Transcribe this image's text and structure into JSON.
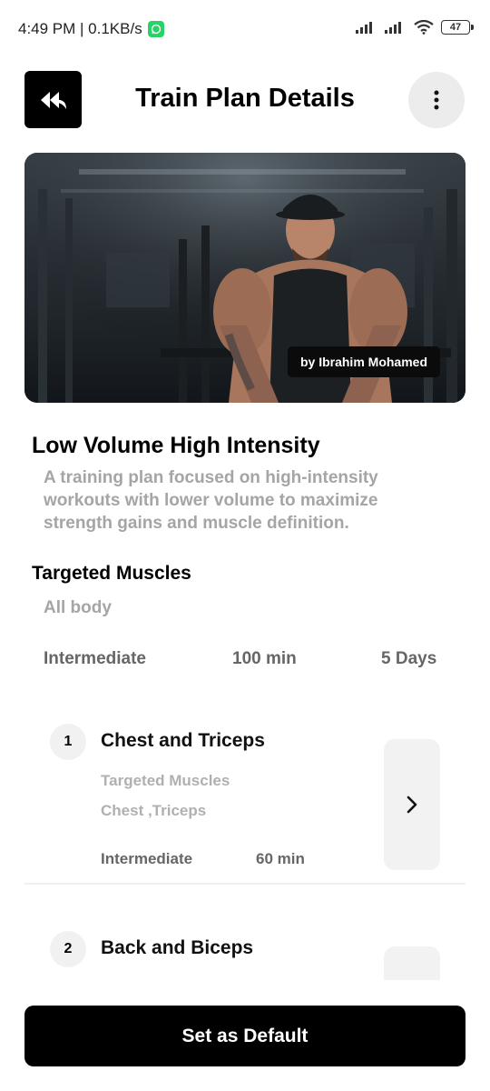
{
  "status_bar": {
    "time_speed": "4:49 PM | 0.1KB/s",
    "battery": "47"
  },
  "header": {
    "title": "Train Plan Details",
    "back_icon": "double-back-arrow-icon",
    "menu_icon": "kebab-menu-icon"
  },
  "hero": {
    "author": "by Ibrahim Mohamed"
  },
  "plan": {
    "title": "Low Volume High Intensity",
    "description": "A training plan focused on high-intensity workouts with lower volume to maximize strength gains and muscle definition.",
    "targeted_label": "Targeted Muscles",
    "targeted_value": "All body",
    "level": "Intermediate",
    "duration": "100 min",
    "days": "5 Days"
  },
  "days": [
    {
      "number": "1",
      "title": "Chest and Triceps",
      "targeted_label": "Targeted Muscles",
      "targeted_value": "Chest ,Triceps",
      "level": "Intermediate",
      "duration": "60 min"
    },
    {
      "number": "2",
      "title": "Back and Biceps"
    }
  ],
  "actions": {
    "set_default": "Set as Default"
  },
  "colors": {
    "primary": "#000000",
    "muted_text": "#a5a5a5",
    "chip_bg": "#f1f1f1"
  }
}
